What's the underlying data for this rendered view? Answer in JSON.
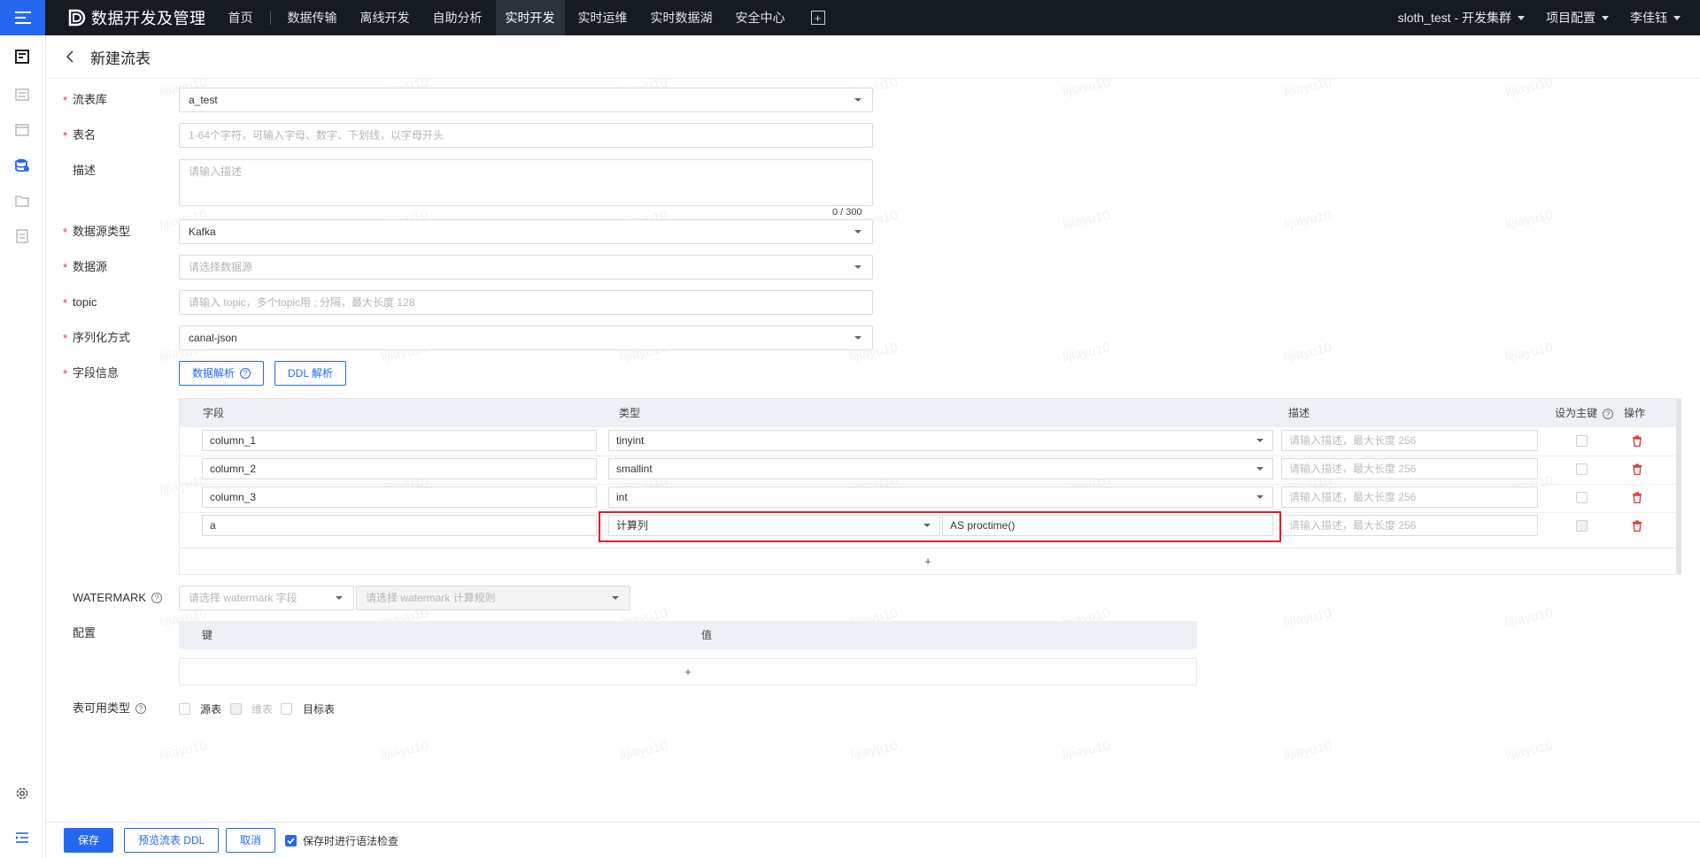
{
  "app": {
    "title": "数据开发及管理"
  },
  "nav": {
    "items": [
      "首页",
      "数据传输",
      "离线开发",
      "自助分析",
      "实时开发",
      "实时运维",
      "实时数据湖",
      "安全中心"
    ],
    "active_index": 4
  },
  "top_right": {
    "cluster": "sloth_test - 开发集群",
    "project_config": "项目配置",
    "user": "李佳钰"
  },
  "page": {
    "title": "新建流表"
  },
  "form": {
    "stream_db": {
      "label": "流表库",
      "value": "a_test"
    },
    "table_name": {
      "label": "表名",
      "placeholder": "1-64个字符，可输入字母、数字、下划线，以字母开头"
    },
    "description": {
      "label": "描述",
      "placeholder": "请输入描述",
      "counter": "0 / 300"
    },
    "datasource_type": {
      "label": "数据源类型",
      "value": "Kafka"
    },
    "datasource": {
      "label": "数据源",
      "placeholder": "请选择数据源"
    },
    "topic": {
      "label": "topic",
      "placeholder": "请输入 topic，多个topic用 ; 分隔，最大长度 128"
    },
    "serialization": {
      "label": "序列化方式",
      "value": "canal-json"
    },
    "fields_info": {
      "label": "字段信息",
      "parse_data_button": "数据解析",
      "parse_ddl_button": "DDL 解析"
    }
  },
  "field_table": {
    "headers": {
      "field": "字段",
      "type": "类型",
      "desc": "描述",
      "primary_key": "设为主键",
      "actions": "操作"
    },
    "desc_placeholder": "请输入描述，最大长度 256",
    "rows": [
      {
        "name": "column_1",
        "type": "tinyint",
        "expr": ""
      },
      {
        "name": "column_2",
        "type": "smallint",
        "expr": ""
      },
      {
        "name": "column_3",
        "type": "int",
        "expr": ""
      },
      {
        "name": "a",
        "type": "计算列",
        "expr": "AS proctime()"
      }
    ],
    "add_symbol": "+"
  },
  "watermark": {
    "label": "WATERMARK",
    "field_placeholder": "请选择 watermark 字段",
    "rule_placeholder": "请选择 watermark 计算规则"
  },
  "config": {
    "label": "配置",
    "headers": {
      "key": "键",
      "value": "值"
    },
    "add_symbol": "+"
  },
  "table_types": {
    "label": "表可用类型",
    "options": [
      "源表",
      "维表",
      "目标表"
    ]
  },
  "footer": {
    "save": "保存",
    "preview_ddl": "预览流表 DDL",
    "cancel": "取消",
    "syntax_check": "保存时进行语法检查"
  },
  "watermark_text": "lijiayu10",
  "colors": {
    "primary": "#2468f2",
    "nav_bg": "#161b22",
    "danger": "#e63a3a",
    "highlight": "#e21f26"
  }
}
